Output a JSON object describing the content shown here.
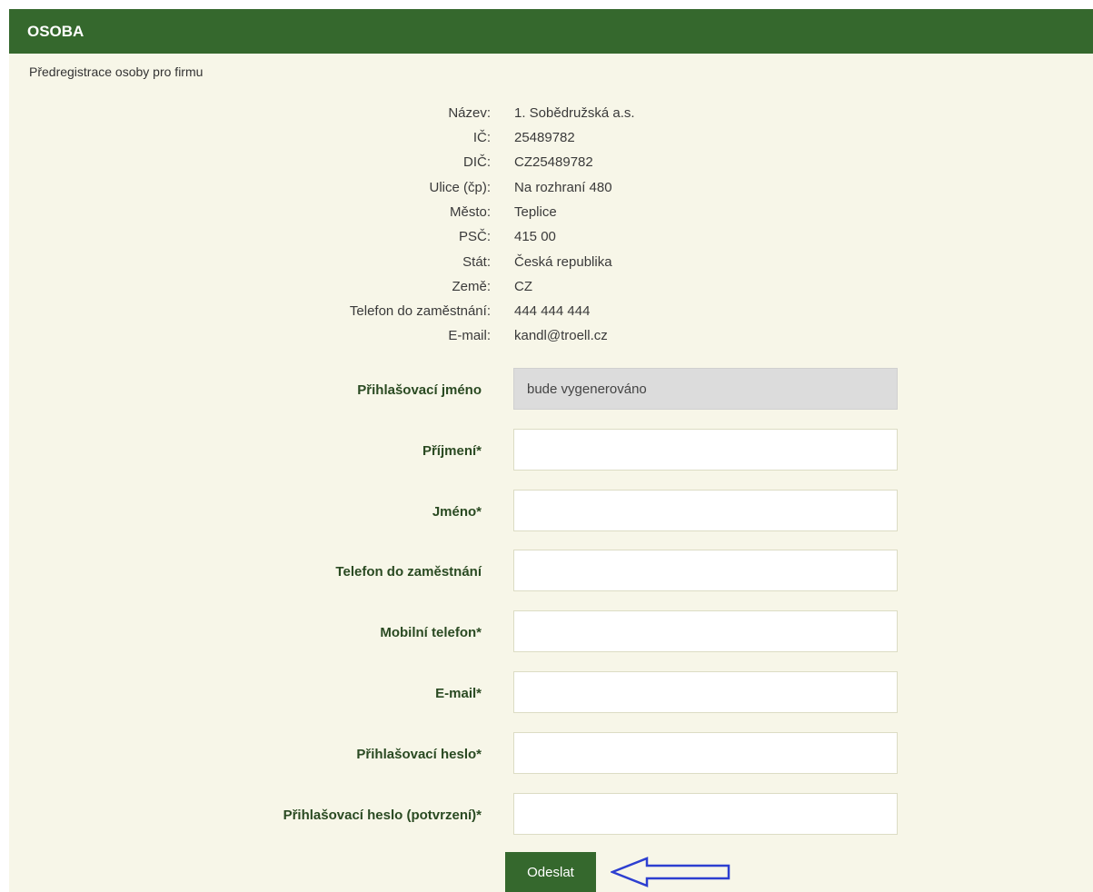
{
  "panel": {
    "title": "OSOBA",
    "subtitle": "Předregistrace osoby pro firmu"
  },
  "company_info": [
    {
      "label": "Název:",
      "value": "1. Sobědružská a.s."
    },
    {
      "label": "IČ:",
      "value": "25489782"
    },
    {
      "label": "DIČ:",
      "value": "CZ25489782"
    },
    {
      "label": "Ulice (čp):",
      "value": "Na rozhraní 480"
    },
    {
      "label": "Město:",
      "value": "Teplice"
    },
    {
      "label": "PSČ:",
      "value": "415 00"
    },
    {
      "label": "Stát:",
      "value": "Česká republika"
    },
    {
      "label": "Země:",
      "value": "CZ"
    },
    {
      "label": "Telefon do zaměstnání:",
      "value": "444 444 444"
    },
    {
      "label": "E-mail:",
      "value": "kandl@troell.cz"
    }
  ],
  "form": {
    "login_name": {
      "label": "Přihlašovací jméno",
      "value": "bude vygenerováno"
    },
    "surname": {
      "label": "Příjmení*",
      "value": ""
    },
    "first_name": {
      "label": "Jméno*",
      "value": ""
    },
    "work_phone": {
      "label": "Telefon do zaměstnání",
      "value": ""
    },
    "mobile_phone": {
      "label": "Mobilní telefon*",
      "value": ""
    },
    "email": {
      "label": "E-mail*",
      "value": ""
    },
    "password": {
      "label": "Přihlašovací heslo*",
      "value": ""
    },
    "password_confirm": {
      "label": "Přihlašovací heslo (potvrzení)*",
      "value": ""
    }
  },
  "submit_label": "Odeslat",
  "icons": {
    "arrow": "arrow-left-icon"
  },
  "colors": {
    "header_bg": "#35682d",
    "panel_bg": "#f7f6e8",
    "arrow": "#2d3fd0"
  }
}
